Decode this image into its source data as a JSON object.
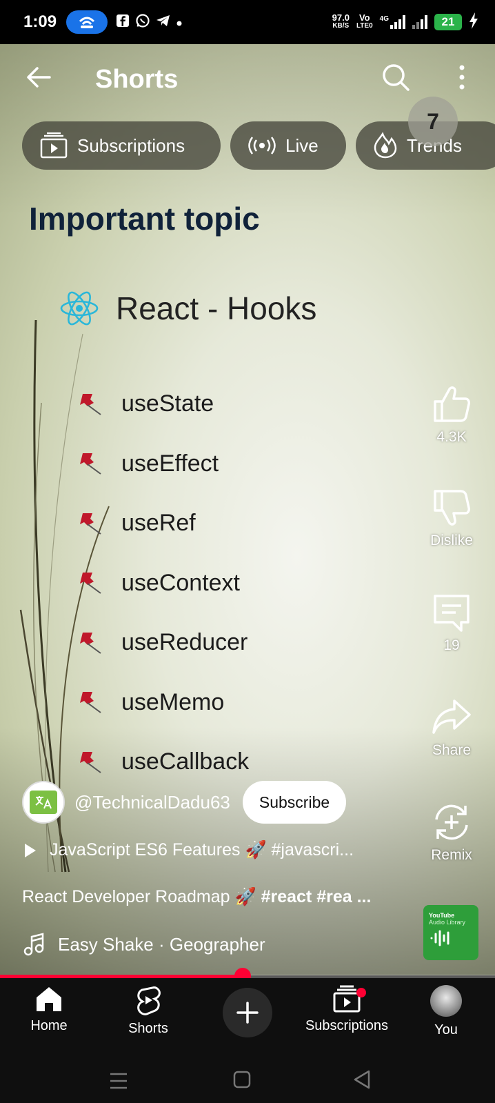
{
  "status_bar": {
    "time": "1:09",
    "net_speed_value": "97.0",
    "net_speed_unit": "KB/S",
    "carrier_top": "Vo",
    "carrier_bottom": "LTE0",
    "network_type": "4G",
    "battery": "21"
  },
  "header": {
    "title": "Shorts",
    "back_icon": "arrow-left-icon",
    "search_icon": "search-icon",
    "more_icon": "more-vert-icon"
  },
  "chips": [
    {
      "label": "Subscriptions",
      "icon": "subscriptions-icon"
    },
    {
      "label": "Live",
      "icon": "live-icon"
    },
    {
      "label": "Trends",
      "icon": "trends-icon"
    }
  ],
  "notification_count": "7",
  "slide": {
    "heading": "Important topic",
    "title": "React - Hooks",
    "hooks": [
      "useState",
      "useEffect",
      "useRef",
      "useContext",
      "useReducer",
      "useMemo",
      "useCallback"
    ]
  },
  "actions": {
    "like_count": "4.3K",
    "dislike_label": "Dislike",
    "comment_count": "19",
    "share_label": "Share",
    "remix_label": "Remix"
  },
  "channel": {
    "handle": "@TechnicalDadu63",
    "subscribe_label": "Subscribe"
  },
  "playlist": {
    "title": "JavaScript ES6 Features 🚀 #javascri..."
  },
  "caption": {
    "text": "React Developer Roadmap 🚀 ",
    "tags": "#react #rea ..."
  },
  "music": {
    "track": "Easy Shake · Geographer",
    "thumb_brand": "YouTube",
    "thumb_subtitle": "Audio Library"
  },
  "progress": {
    "fraction": 0.49
  },
  "bottom_nav": {
    "home": "Home",
    "shorts": "Shorts",
    "subscriptions": "Subscriptions",
    "you": "You"
  },
  "colors": {
    "accent": "#ff0033",
    "battery": "#2bb34a",
    "hotspot": "#1a73e8",
    "react": "#2ab7d9"
  }
}
